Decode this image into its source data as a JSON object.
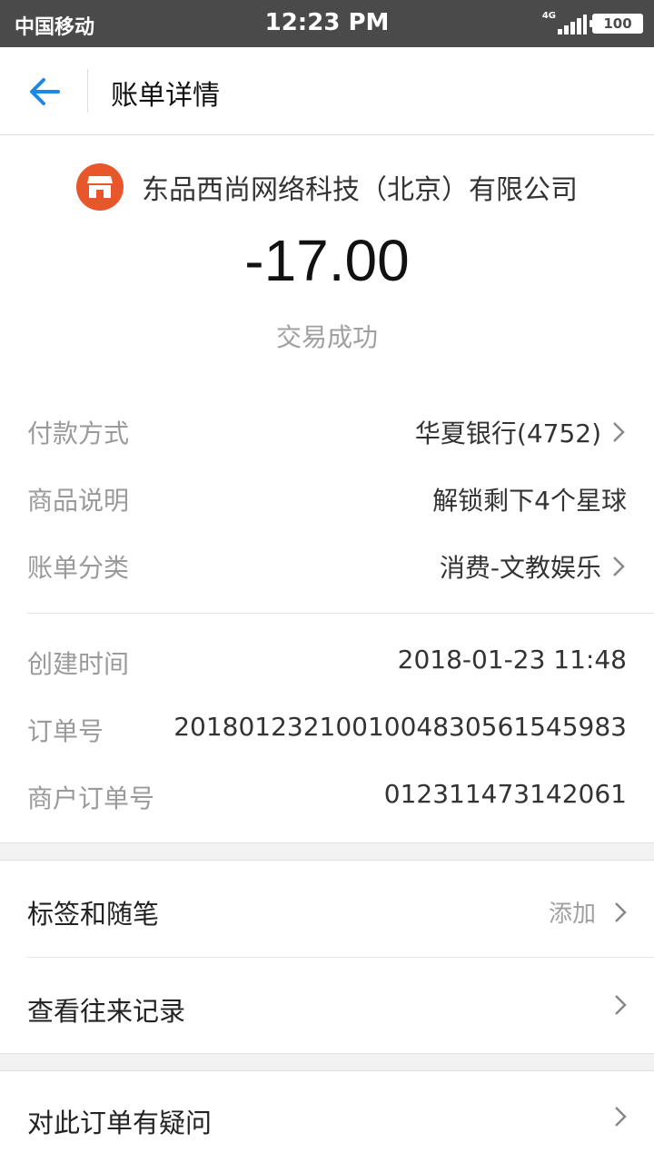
{
  "status_bar": {
    "carrier": "中国移动",
    "time": "12:23 PM",
    "network": "4G",
    "battery": "100"
  },
  "nav": {
    "title": "账单详情"
  },
  "transaction": {
    "merchant": "东品西尚网络科技（北京）有限公司",
    "amount": "-17.00",
    "status": "交易成功",
    "merchant_icon_color": "#e8572b"
  },
  "details": [
    {
      "label": "付款方式",
      "value": "华夏银行(4752)"
    },
    {
      "label": "商品说明",
      "value": "解锁剩下4个星球"
    },
    {
      "label": "账单分类",
      "value": "消费-文教娱乐"
    }
  ],
  "order_info": [
    {
      "label": "创建时间",
      "value": "2018-01-23 11:48"
    },
    {
      "label": "订单号",
      "value": "20180123210010048305615459​83"
    },
    {
      "label": "商户订单号",
      "value": "012311473142061"
    }
  ],
  "actions": {
    "tags_label": "标签和随笔",
    "tags_hint": "添加",
    "history_label": "查看往来记录",
    "question_label": "对此订单有疑问"
  },
  "colors": {
    "accent": "#1e88e5",
    "status_bar": "#4a4a4a",
    "label_gray": "#9a9a9a"
  }
}
